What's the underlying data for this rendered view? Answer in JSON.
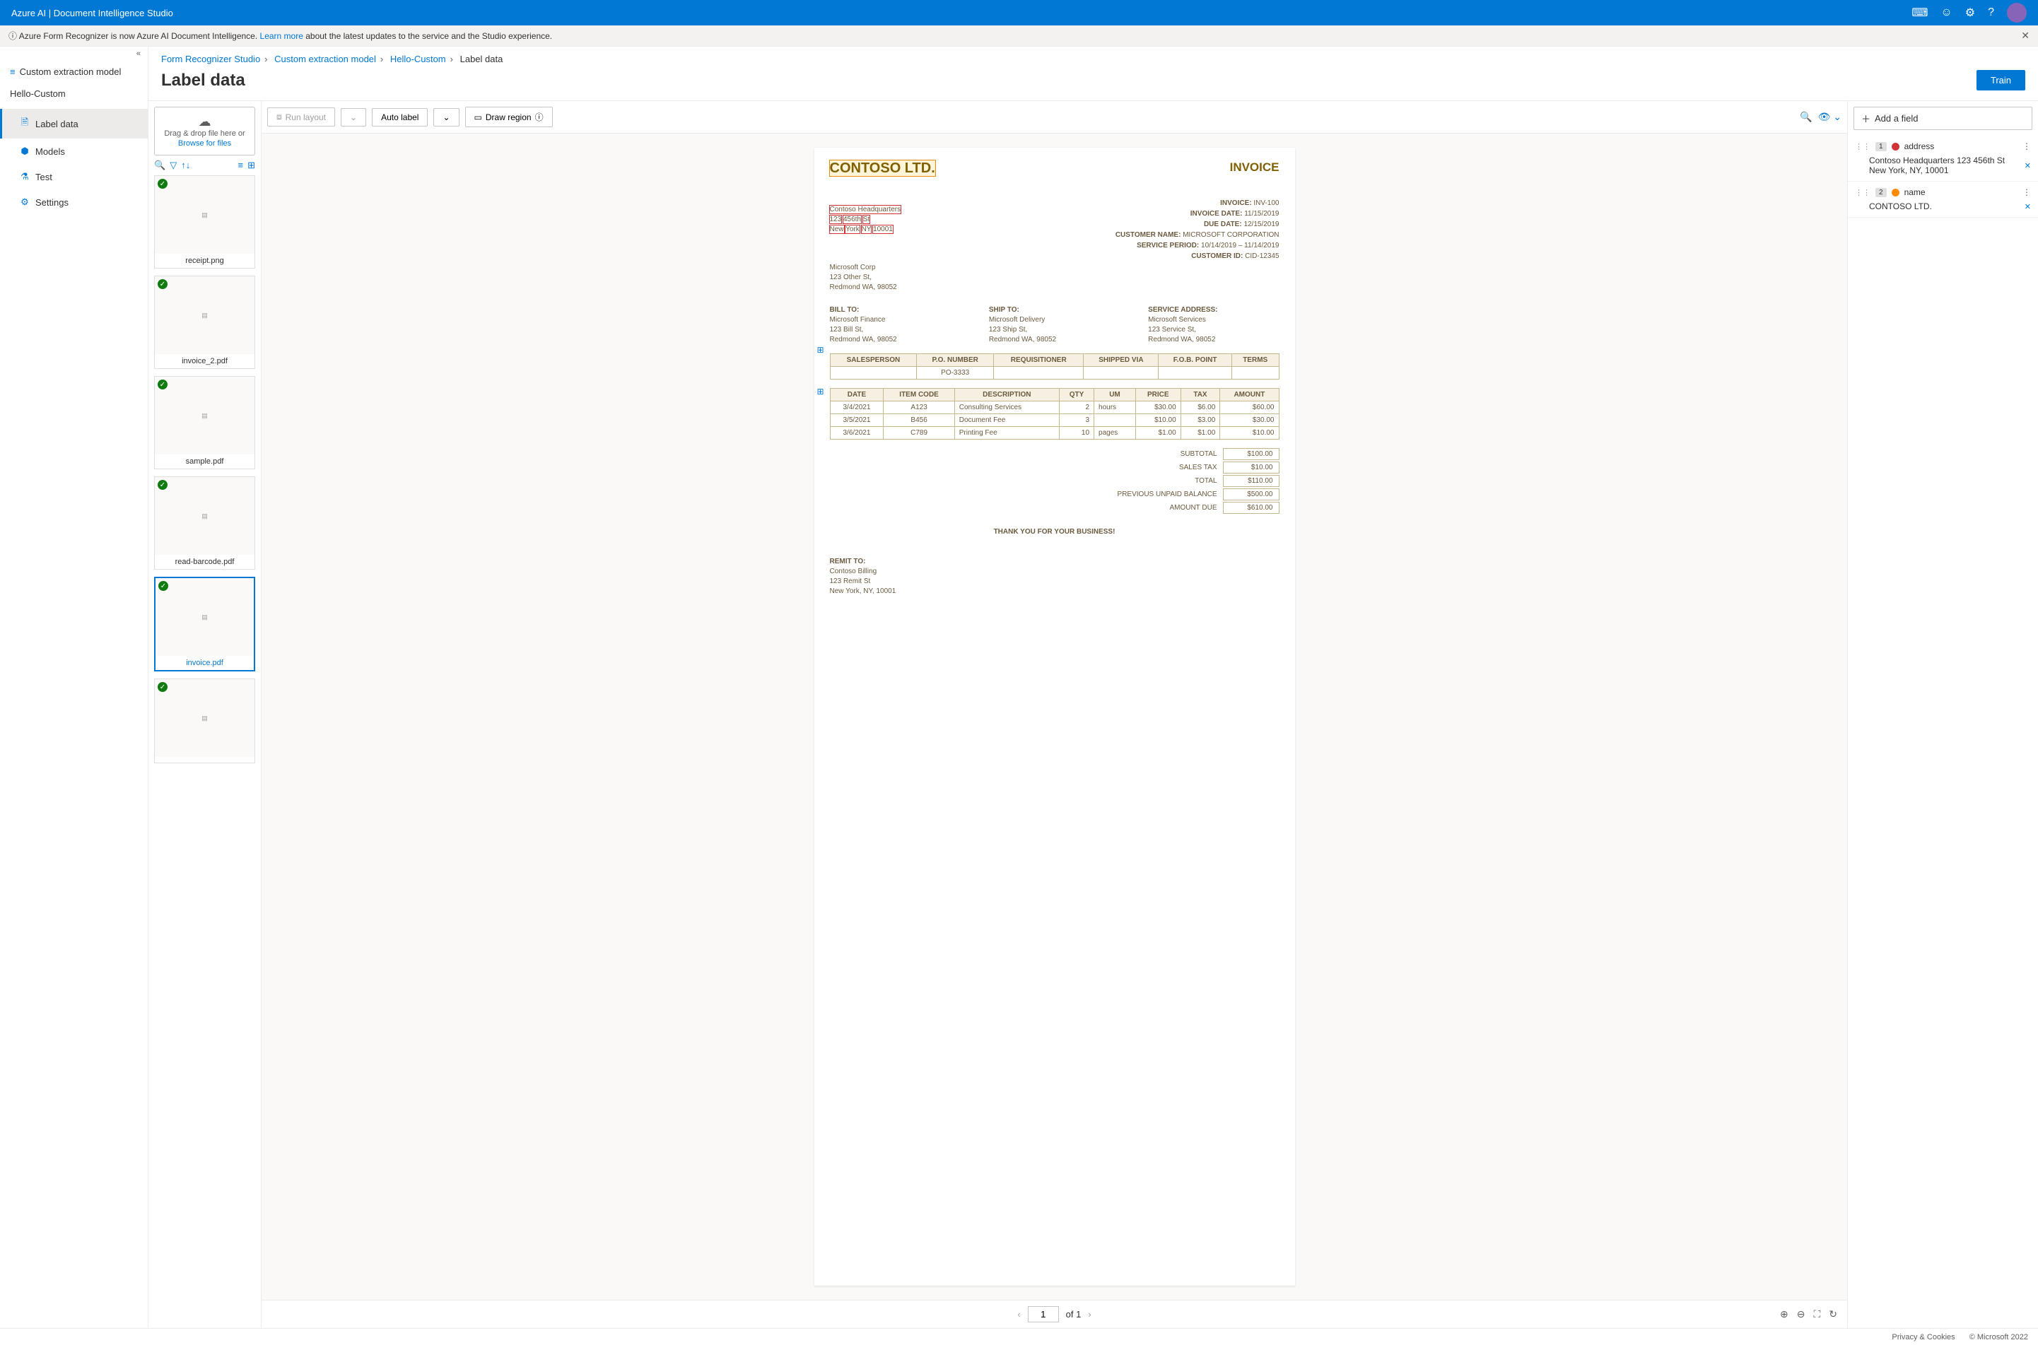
{
  "topbar": {
    "title": "Azure AI | Document Intelligence Studio"
  },
  "banner": {
    "info_icon": "ⓘ",
    "text_before": "Azure Form Recognizer is now Azure AI Document Intelligence. ",
    "learn_more": "Learn more",
    "text_after": " about the latest updates to the service and the Studio experience."
  },
  "sidebar": {
    "header": "Custom extraction model",
    "project": "Hello-Custom",
    "items": [
      {
        "icon": "🗎",
        "label": "Label data",
        "active": true
      },
      {
        "icon": "⬢",
        "label": "Models"
      },
      {
        "icon": "⚗",
        "label": "Test"
      },
      {
        "icon": "⚙",
        "label": "Settings"
      }
    ]
  },
  "breadcrumb": {
    "items": [
      "Form Recognizer Studio",
      "Custom extraction model",
      "Hello-Custom"
    ],
    "current": "Label data"
  },
  "page_title": "Label data",
  "train_label": "Train",
  "upload": {
    "drag": "Drag & drop file here or",
    "browse": "Browse for files"
  },
  "thumbs": [
    {
      "name": "receipt.png",
      "check": true
    },
    {
      "name": "invoice_2.pdf",
      "check": true
    },
    {
      "name": "sample.pdf",
      "check": true
    },
    {
      "name": "read-barcode.pdf",
      "check": true
    },
    {
      "name": "invoice.pdf",
      "check": true,
      "selected": true
    },
    {
      "name": "",
      "check": true
    }
  ],
  "toolbar": {
    "run_layout": "Run layout",
    "auto_label": "Auto label",
    "draw_region": "Draw region"
  },
  "doc": {
    "company": "CONTOSO LTD.",
    "invoice_hdr": "INVOICE",
    "addr1": "Contoso Headquarters",
    "addr2a": "123",
    "addr2b": "456th",
    "addr2c": "St",
    "addr3a": "New",
    "addr3b": "York",
    "addr3c": "NY",
    "addr3d": "10001",
    "meta": {
      "inv_no_l": "INVOICE:",
      "inv_no": "INV-100",
      "inv_date_l": "INVOICE DATE:",
      "inv_date": "11/15/2019",
      "due_l": "DUE DATE:",
      "due": "12/15/2019",
      "cust_l": "CUSTOMER NAME:",
      "cust": "MICROSOFT CORPORATION",
      "svc_l": "SERVICE PERIOD:",
      "svc": "10/14/2019 – 11/14/2019",
      "cid_l": "CUSTOMER ID:",
      "cid": "CID-12345"
    },
    "from": {
      "l1": "Microsoft Corp",
      "l2": "123 Other St,",
      "l3": "Redmond WA, 98052"
    },
    "bill": {
      "h": "BILL TO:",
      "l1": "Microsoft Finance",
      "l2": "123 Bill St,",
      "l3": "Redmond WA, 98052"
    },
    "ship": {
      "h": "SHIP TO:",
      "l1": "Microsoft Delivery",
      "l2": "123 Ship St,",
      "l3": "Redmond WA, 98052"
    },
    "svc": {
      "h": "SERVICE ADDRESS:",
      "l1": "Microsoft Services",
      "l2": "123 Service St,",
      "l3": "Redmond WA, 98052"
    },
    "t1": {
      "headers": [
        "SALESPERSON",
        "P.O. NUMBER",
        "REQUISITIONER",
        "SHIPPED VIA",
        "F.O.B. POINT",
        "TERMS"
      ],
      "po": "PO-3333"
    },
    "t2": {
      "headers": [
        "DATE",
        "ITEM CODE",
        "DESCRIPTION",
        "QTY",
        "UM",
        "PRICE",
        "TAX",
        "AMOUNT"
      ],
      "rows": [
        [
          "3/4/2021",
          "A123",
          "Consulting Services",
          "2",
          "hours",
          "$30.00",
          "$6.00",
          "$60.00"
        ],
        [
          "3/5/2021",
          "B456",
          "Document Fee",
          "3",
          "",
          "$10.00",
          "$3.00",
          "$30.00"
        ],
        [
          "3/6/2021",
          "C789",
          "Printing Fee",
          "10",
          "pages",
          "$1.00",
          "$1.00",
          "$10.00"
        ]
      ]
    },
    "totals": [
      [
        "SUBTOTAL",
        "$100.00"
      ],
      [
        "SALES TAX",
        "$10.00"
      ],
      [
        "TOTAL",
        "$110.00"
      ],
      [
        "PREVIOUS UNPAID BALANCE",
        "$500.00"
      ],
      [
        "AMOUNT DUE",
        "$610.00"
      ]
    ],
    "thanks": "THANK YOU FOR YOUR BUSINESS!",
    "remit": {
      "h": "REMIT TO:",
      "l1": "Contoso Billing",
      "l2": "123 Remit St",
      "l3": "New York, NY, 10001"
    }
  },
  "pager": {
    "page": "1",
    "of": "of 1"
  },
  "fields": {
    "add": "Add a field",
    "items": [
      {
        "num": "1",
        "color": "red",
        "name": "address",
        "value": "Contoso Headquarters 123 456th St New York, NY, 10001"
      },
      {
        "num": "2",
        "color": "orange",
        "name": "name",
        "value": "CONTOSO LTD."
      }
    ]
  },
  "footer": {
    "privacy": "Privacy & Cookies",
    "copyright": "© Microsoft 2022"
  }
}
